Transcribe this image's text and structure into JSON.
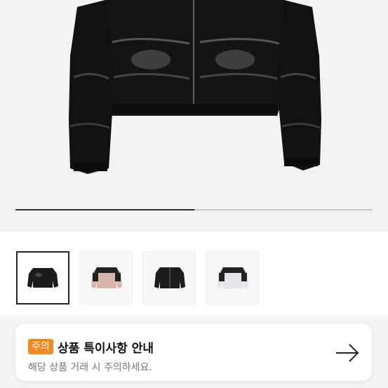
{
  "gallery": {
    "progress": 0.5,
    "thumbnails": [
      {
        "label": "black-jacket",
        "color": "#1a1a1a"
      },
      {
        "label": "pink-black-jacket",
        "color": "#d7b5a8"
      },
      {
        "label": "black-jacket-2",
        "color": "#1d1d1d"
      },
      {
        "label": "white-black-jacket",
        "color": "#e6e6ea"
      }
    ]
  },
  "notice": {
    "badge": "주의",
    "title": "상품 특이사항 안내",
    "subtitle": "해당 상품 거래 시 주의하세요."
  },
  "colors": {
    "accent": "#f08a24",
    "background": "#f3f3f5"
  }
}
